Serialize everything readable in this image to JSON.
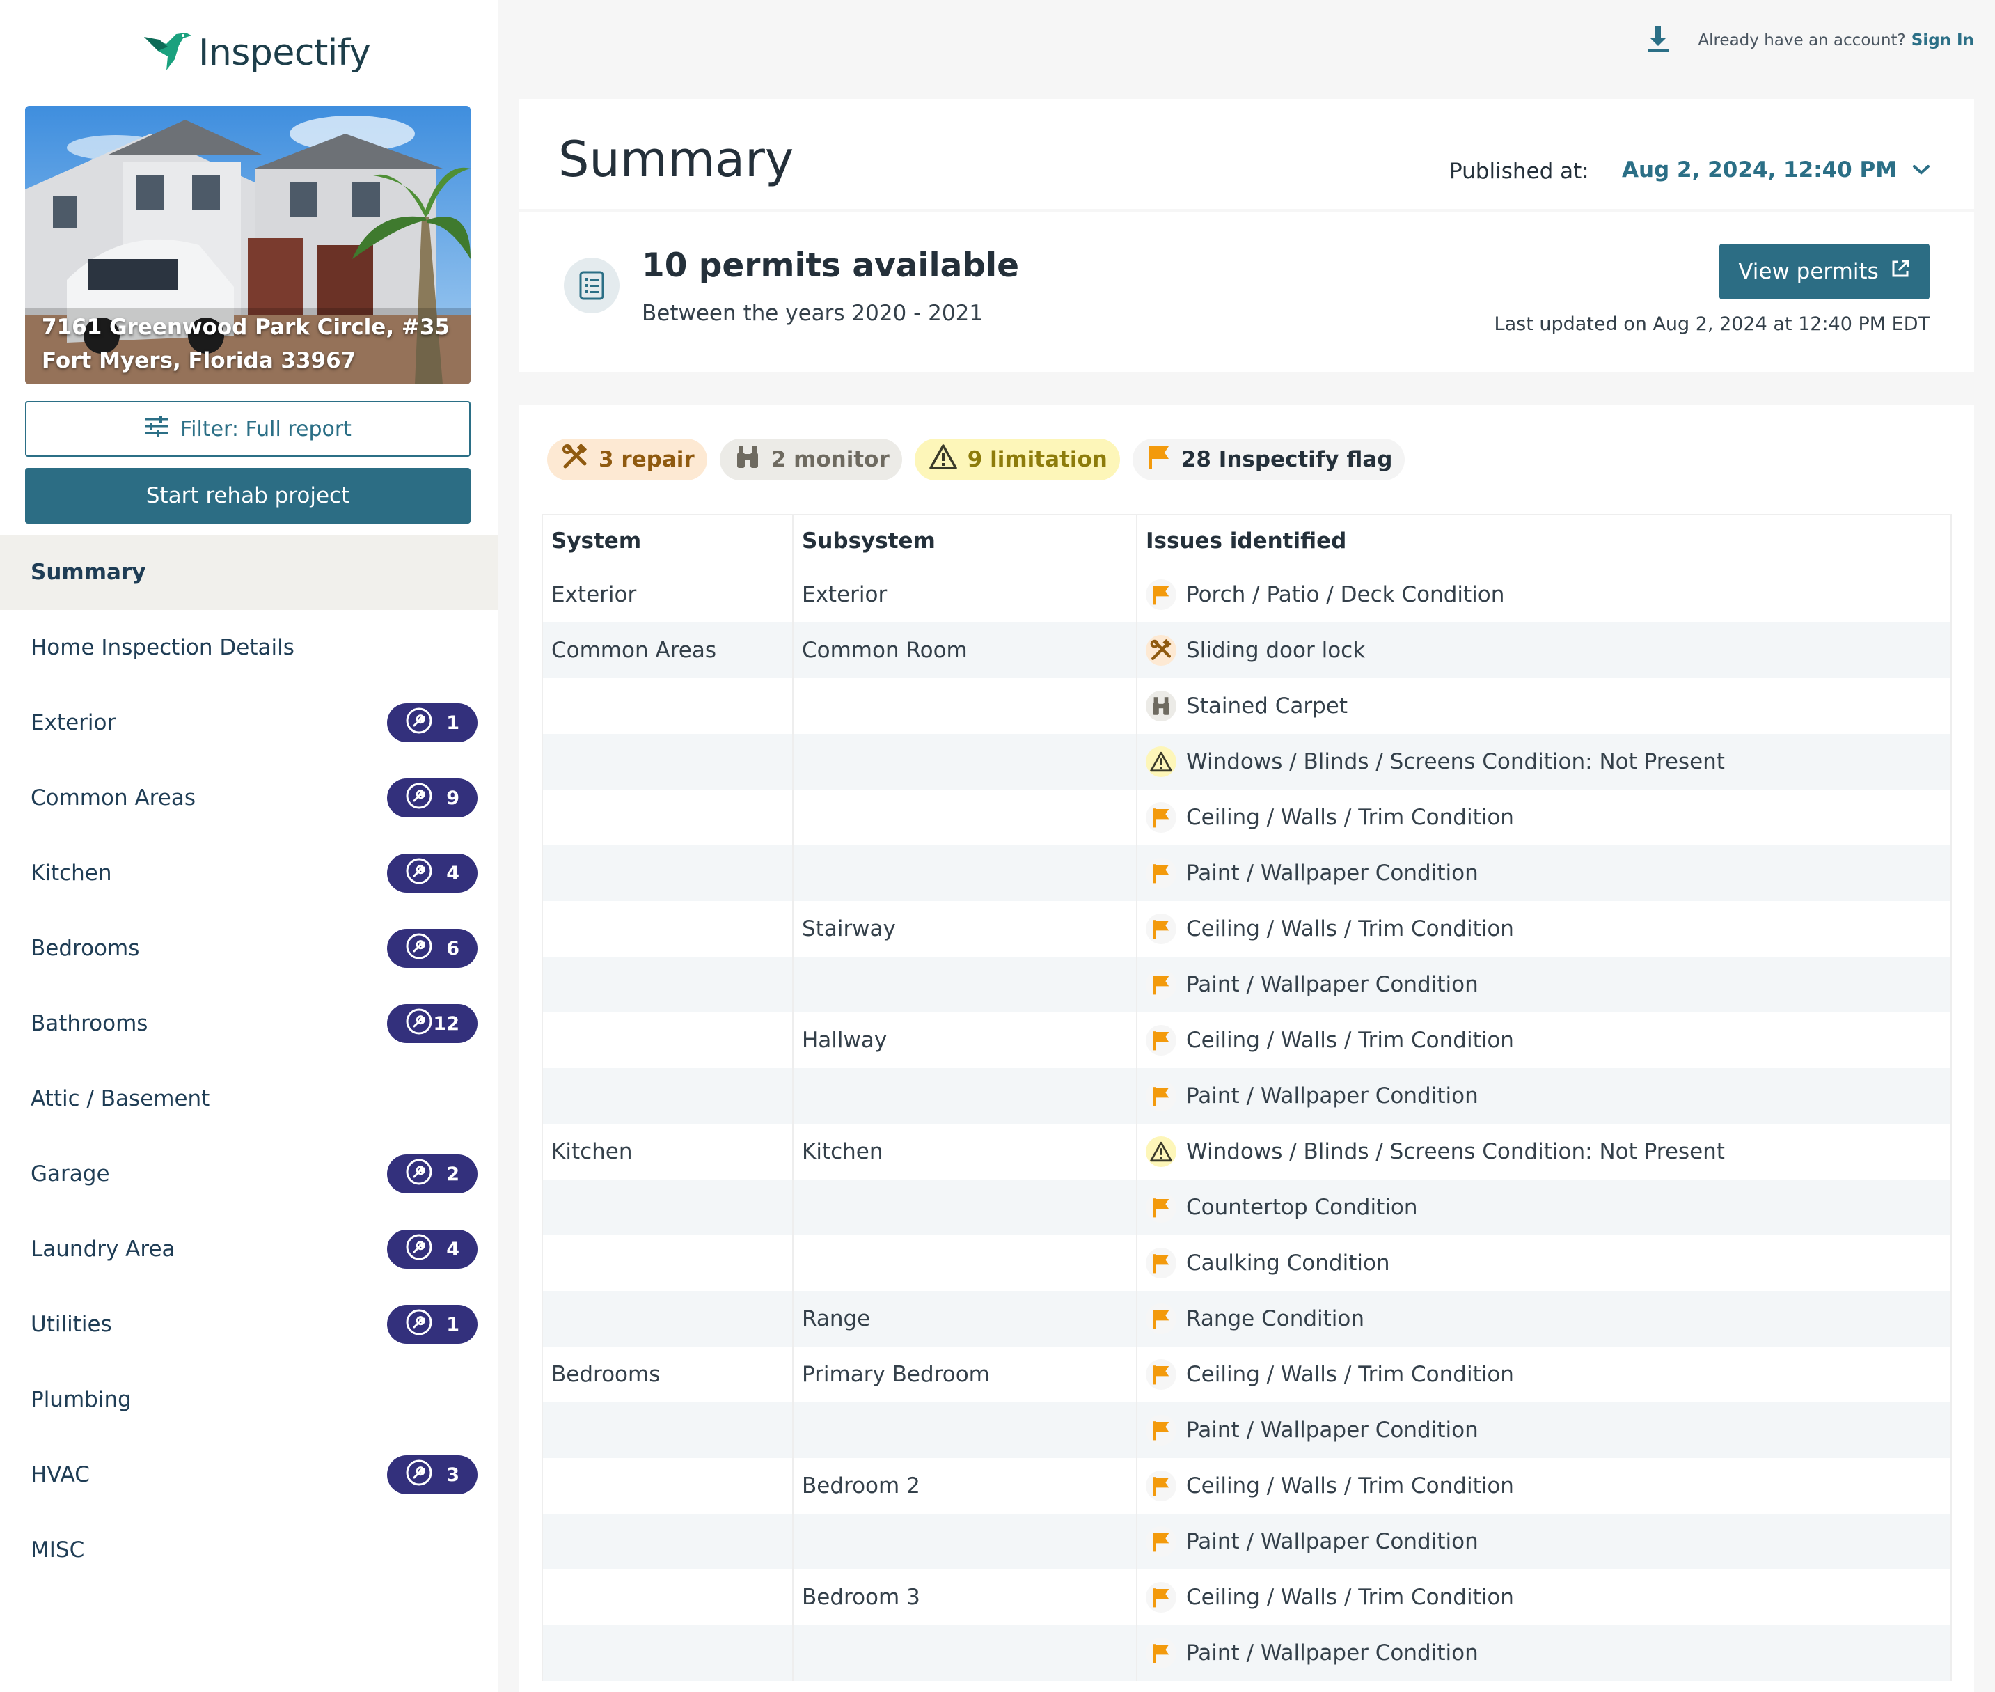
{
  "app": {
    "logo_text": "Inspectify"
  },
  "property": {
    "address_line1": "7161 Greenwood Park Circle, #35",
    "address_line2": "Fort Myers, Florida 33967"
  },
  "sidebar": {
    "filter_label": "Filter: Full report",
    "rehab_label": "Start rehab project",
    "nav": [
      {
        "label": "Summary",
        "active": true,
        "count": null
      },
      {
        "label": "Home Inspection Details",
        "count": null
      },
      {
        "label": "Exterior",
        "count": "1"
      },
      {
        "label": "Common Areas",
        "count": "9"
      },
      {
        "label": "Kitchen",
        "count": "4"
      },
      {
        "label": "Bedrooms",
        "count": "6"
      },
      {
        "label": "Bathrooms",
        "count": "12"
      },
      {
        "label": "Attic / Basement",
        "count": null
      },
      {
        "label": "Garage",
        "count": "2"
      },
      {
        "label": "Laundry Area",
        "count": "4"
      },
      {
        "label": "Utilities",
        "count": "1"
      },
      {
        "label": "Plumbing",
        "count": null
      },
      {
        "label": "HVAC",
        "count": "3"
      },
      {
        "label": "MISC",
        "count": null
      }
    ]
  },
  "topbar": {
    "account_prompt": "Already have an account?",
    "sign_in": "Sign In"
  },
  "summary": {
    "title": "Summary",
    "published_label": "Published at:",
    "published_value": "Aug 2, 2024, 12:40 PM"
  },
  "permits": {
    "title": "10 permits available",
    "subtitle": "Between the years 2020 - 2021",
    "button": "View permits",
    "last_updated": "Last updated on Aug 2, 2024 at 12:40 PM EDT"
  },
  "chips": {
    "repair": "3 repair",
    "monitor": "2 monitor",
    "limitation": "9 limitation",
    "flag": "28 Inspectify flag"
  },
  "table": {
    "headers": {
      "system": "System",
      "subsystem": "Subsystem",
      "issues": "Issues identified"
    },
    "rows": [
      {
        "system": "Exterior",
        "subsystem": "Exterior",
        "type": "flag",
        "issue": "Porch / Patio / Deck Condition"
      },
      {
        "system": "Common Areas",
        "subsystem": "Common Room",
        "type": "repair",
        "issue": "Sliding door lock"
      },
      {
        "system": "",
        "subsystem": "",
        "type": "monitor",
        "issue": "Stained Carpet"
      },
      {
        "system": "",
        "subsystem": "",
        "type": "limitation",
        "issue": "Windows / Blinds / Screens Condition: Not Present"
      },
      {
        "system": "",
        "subsystem": "",
        "type": "flag",
        "issue": "Ceiling / Walls / Trim Condition"
      },
      {
        "system": "",
        "subsystem": "",
        "type": "flag",
        "issue": "Paint / Wallpaper Condition"
      },
      {
        "system": "",
        "subsystem": "Stairway",
        "type": "flag",
        "issue": "Ceiling / Walls / Trim Condition"
      },
      {
        "system": "",
        "subsystem": "",
        "type": "flag",
        "issue": "Paint / Wallpaper Condition"
      },
      {
        "system": "",
        "subsystem": "Hallway",
        "type": "flag",
        "issue": "Ceiling / Walls / Trim Condition"
      },
      {
        "system": "",
        "subsystem": "",
        "type": "flag",
        "issue": "Paint / Wallpaper Condition"
      },
      {
        "system": "Kitchen",
        "subsystem": "Kitchen",
        "type": "limitation",
        "issue": "Windows / Blinds / Screens Condition: Not Present"
      },
      {
        "system": "",
        "subsystem": "",
        "type": "flag",
        "issue": "Countertop Condition"
      },
      {
        "system": "",
        "subsystem": "",
        "type": "flag",
        "issue": "Caulking Condition"
      },
      {
        "system": "",
        "subsystem": "Range",
        "type": "flag",
        "issue": "Range Condition"
      },
      {
        "system": "Bedrooms",
        "subsystem": "Primary Bedroom",
        "type": "flag",
        "issue": "Ceiling / Walls / Trim Condition"
      },
      {
        "system": "",
        "subsystem": "",
        "type": "flag",
        "issue": "Paint / Wallpaper Condition"
      },
      {
        "system": "",
        "subsystem": "Bedroom 2",
        "type": "flag",
        "issue": "Ceiling / Walls / Trim Condition"
      },
      {
        "system": "",
        "subsystem": "",
        "type": "flag",
        "issue": "Paint / Wallpaper Condition"
      },
      {
        "system": "",
        "subsystem": "Bedroom 3",
        "type": "flag",
        "issue": "Ceiling / Walls / Trim Condition"
      },
      {
        "system": "",
        "subsystem": "",
        "type": "flag",
        "issue": "Paint / Wallpaper Condition"
      }
    ]
  },
  "icons": {
    "repair": "wrench-hammer-icon",
    "monitor": "binoculars-icon",
    "limitation": "warning-triangle-icon",
    "flag": "flag-icon",
    "nav_badge": "wrench-icon"
  },
  "colors": {
    "brand": "#2c6d84",
    "badge": "#33307c",
    "flag": "#f39a0c",
    "repair": "#8f5a10",
    "limitation": "#8d7c0b"
  }
}
